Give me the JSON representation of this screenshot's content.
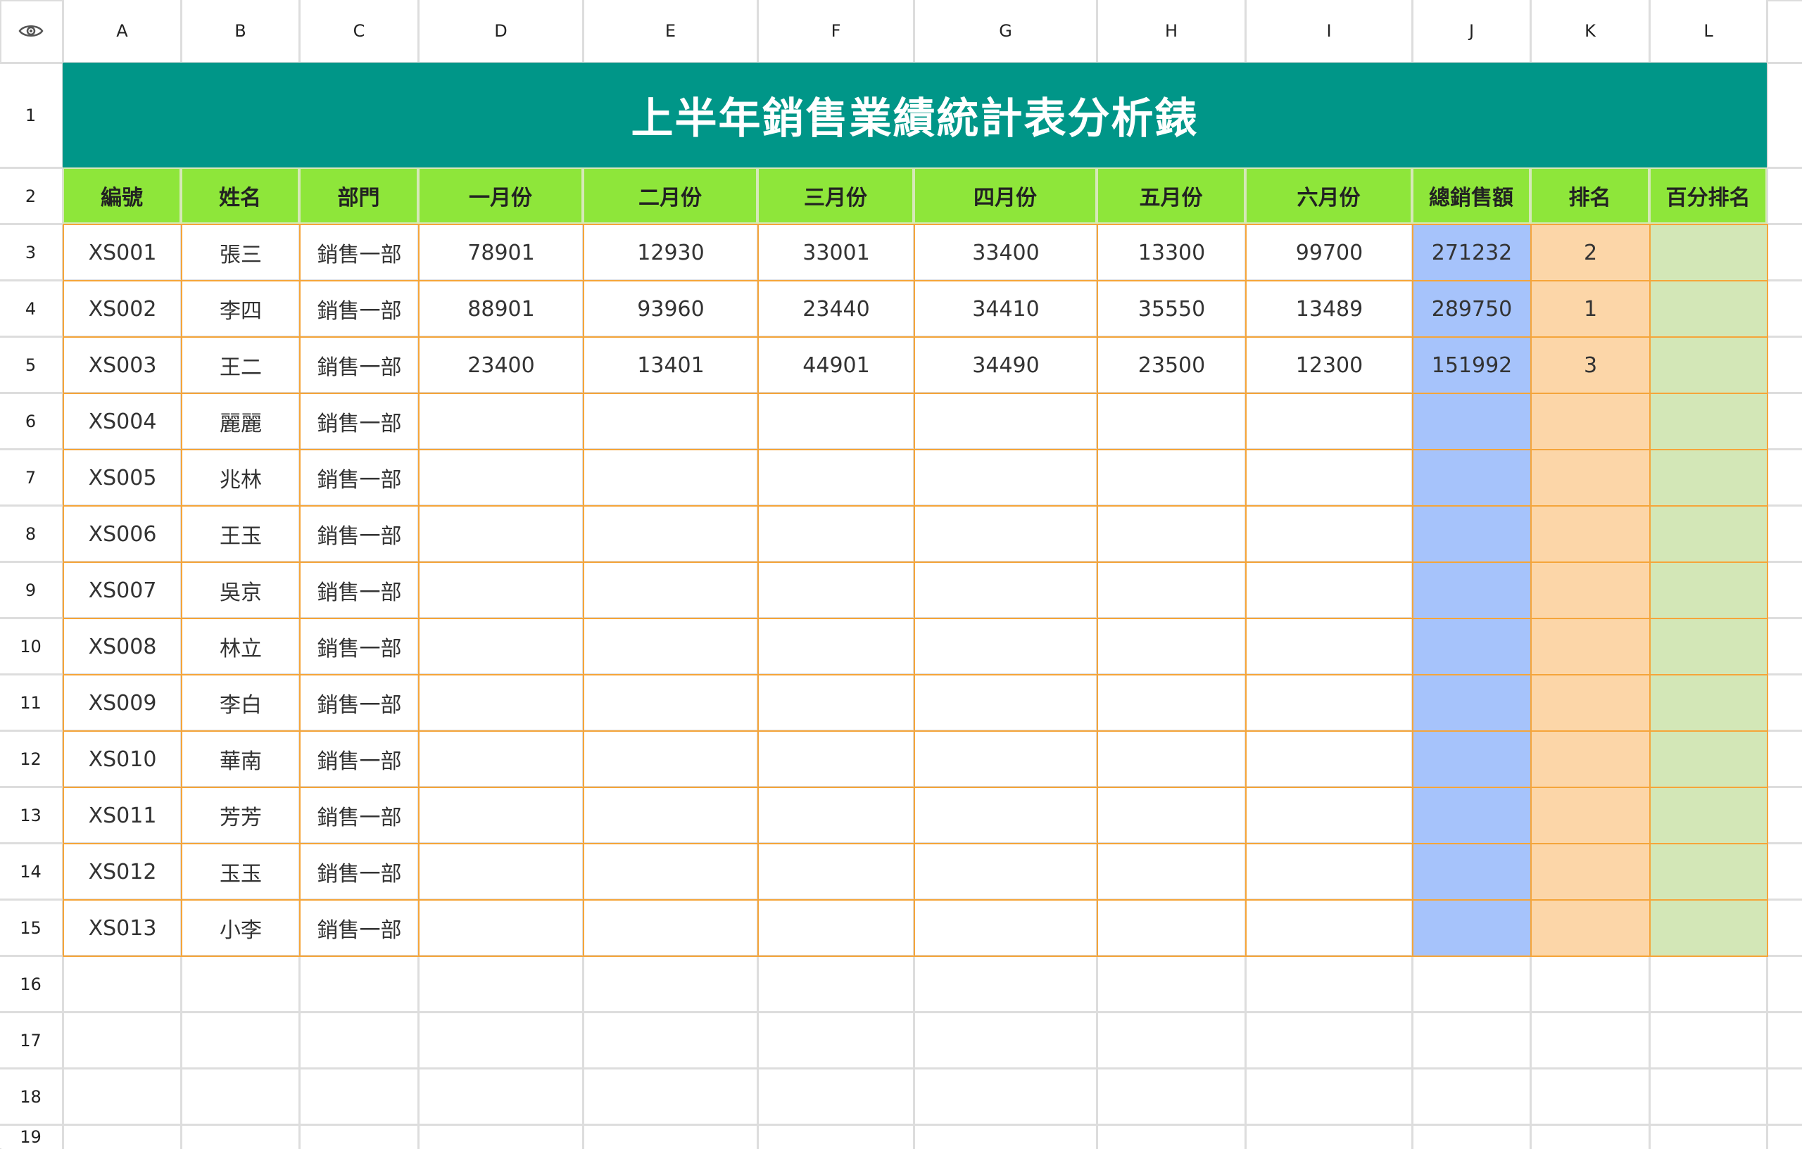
{
  "sheet": {
    "column_headers": [
      "A",
      "B",
      "C",
      "D",
      "E",
      "F",
      "G",
      "H",
      "I",
      "J",
      "K",
      "L"
    ],
    "row_numbers": [
      "1",
      "2",
      "3",
      "4",
      "5",
      "6",
      "7",
      "8",
      "9",
      "10",
      "11",
      "12",
      "13",
      "14",
      "15",
      "16",
      "17",
      "18",
      "19"
    ],
    "title": "上半年銷售業績統計表分析錶",
    "table_headers": [
      "編號",
      "姓名",
      "部門",
      "一月份",
      "二月份",
      "三月份",
      "四月份",
      "五月份",
      "六月份",
      "總銷售額",
      "排名",
      "百分排名"
    ],
    "rows": [
      [
        "XS001",
        "張三",
        "銷售一部",
        "78901",
        "12930",
        "33001",
        "33400",
        "13300",
        "99700",
        "271232",
        "2",
        ""
      ],
      [
        "XS002",
        "李四",
        "銷售一部",
        "88901",
        "93960",
        "23440",
        "34410",
        "35550",
        "13489",
        "289750",
        "1",
        ""
      ],
      [
        "XS003",
        "王二",
        "銷售一部",
        "23400",
        "13401",
        "44901",
        "34490",
        "23500",
        "12300",
        "151992",
        "3",
        ""
      ],
      [
        "XS004",
        "麗麗",
        "銷售一部",
        "",
        "",
        "",
        "",
        "",
        "",
        "",
        "",
        ""
      ],
      [
        "XS005",
        "兆林",
        "銷售一部",
        "",
        "",
        "",
        "",
        "",
        "",
        "",
        "",
        ""
      ],
      [
        "XS006",
        "王玉",
        "銷售一部",
        "",
        "",
        "",
        "",
        "",
        "",
        "",
        "",
        ""
      ],
      [
        "XS007",
        "吳京",
        "銷售一部",
        "",
        "",
        "",
        "",
        "",
        "",
        "",
        "",
        ""
      ],
      [
        "XS008",
        "林立",
        "銷售一部",
        "",
        "",
        "",
        "",
        "",
        "",
        "",
        "",
        ""
      ],
      [
        "XS009",
        "李白",
        "銷售一部",
        "",
        "",
        "",
        "",
        "",
        "",
        "",
        "",
        ""
      ],
      [
        "XS010",
        "華南",
        "銷售一部",
        "",
        "",
        "",
        "",
        "",
        "",
        "",
        "",
        ""
      ],
      [
        "XS011",
        "芳芳",
        "銷售一部",
        "",
        "",
        "",
        "",
        "",
        "",
        "",
        "",
        ""
      ],
      [
        "XS012",
        "玉玉",
        "銷售一部",
        "",
        "",
        "",
        "",
        "",
        "",
        "",
        "",
        ""
      ],
      [
        "XS013",
        "小李",
        "銷售一部",
        "",
        "",
        "",
        "",
        "",
        "",
        "",
        "",
        ""
      ]
    ],
    "colors": {
      "title_bg": "#009688",
      "header_bg": "#8ee63a",
      "border": "#f5a53a",
      "total_col_bg": "#a6c3fb",
      "rank_col_bg": "#fcd6a8",
      "percent_rank_col_bg": "#d3e7b7"
    },
    "corner_icon": "eye-icon"
  }
}
